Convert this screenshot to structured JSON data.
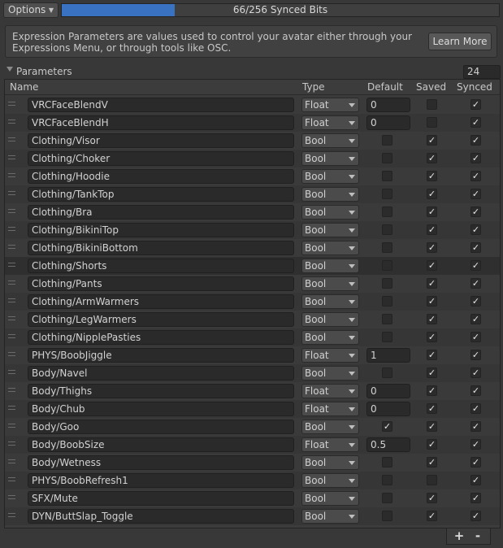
{
  "toolbar": {
    "options_label": "Options",
    "progress_fraction": 0.2578,
    "progress_text": "66/256 Synced Bits"
  },
  "info": {
    "message": "Expression Parameters are values used to control your avatar either through your Expressions Menu, or through tools like OSC.",
    "learn_more": "Learn More"
  },
  "parameters": {
    "header": "Parameters",
    "count": "24",
    "columns": {
      "name": "Name",
      "type": "Type",
      "default": "Default",
      "saved": "Saved",
      "synced": "Synced"
    },
    "rows": [
      {
        "name": "VRCFaceBlendV",
        "type": "Float",
        "default": "0",
        "saved": false,
        "synced": true
      },
      {
        "name": "VRCFaceBlendH",
        "type": "Float",
        "default": "0",
        "saved": false,
        "synced": true
      },
      {
        "name": "Clothing/Visor",
        "type": "Bool",
        "default": false,
        "saved": true,
        "synced": true
      },
      {
        "name": "Clothing/Choker",
        "type": "Bool",
        "default": false,
        "saved": true,
        "synced": true
      },
      {
        "name": "Clothing/Hoodie",
        "type": "Bool",
        "default": false,
        "saved": true,
        "synced": true
      },
      {
        "name": "Clothing/TankTop",
        "type": "Bool",
        "default": false,
        "saved": true,
        "synced": true
      },
      {
        "name": "Clothing/Bra",
        "type": "Bool",
        "default": false,
        "saved": true,
        "synced": true
      },
      {
        "name": "Clothing/BikiniTop",
        "type": "Bool",
        "default": false,
        "saved": true,
        "synced": true
      },
      {
        "name": "Clothing/BikiniBottom",
        "type": "Bool",
        "default": false,
        "saved": true,
        "synced": true
      },
      {
        "name": "Clothing/Shorts",
        "type": "Bool",
        "default": false,
        "saved": true,
        "synced": true,
        "selected": true
      },
      {
        "name": "Clothing/Pants",
        "type": "Bool",
        "default": false,
        "saved": true,
        "synced": true
      },
      {
        "name": "Clothing/ArmWarmers",
        "type": "Bool",
        "default": false,
        "saved": true,
        "synced": true
      },
      {
        "name": "Clothing/LegWarmers",
        "type": "Bool",
        "default": false,
        "saved": true,
        "synced": true
      },
      {
        "name": "Clothing/NipplePasties",
        "type": "Bool",
        "default": false,
        "saved": true,
        "synced": true
      },
      {
        "name": "PHYS/BoobJiggle",
        "type": "Float",
        "default": "1",
        "saved": true,
        "synced": true
      },
      {
        "name": "Body/Navel",
        "type": "Bool",
        "default": false,
        "saved": true,
        "synced": true
      },
      {
        "name": "Body/Thighs",
        "type": "Float",
        "default": "0",
        "saved": true,
        "synced": true
      },
      {
        "name": "Body/Chub",
        "type": "Float",
        "default": "0",
        "saved": true,
        "synced": true
      },
      {
        "name": "Body/Goo",
        "type": "Bool",
        "default": true,
        "saved": true,
        "synced": true
      },
      {
        "name": "Body/BoobSize",
        "type": "Float",
        "default": "0.5",
        "saved": true,
        "synced": true
      },
      {
        "name": "Body/Wetness",
        "type": "Bool",
        "default": false,
        "saved": true,
        "synced": true
      },
      {
        "name": "PHYS/BoobRefresh1",
        "type": "Bool",
        "default": false,
        "saved": false,
        "synced": true
      },
      {
        "name": "SFX/Mute",
        "type": "Bool",
        "default": false,
        "saved": true,
        "synced": true
      },
      {
        "name": "DYN/ButtSlap_Toggle",
        "type": "Bool",
        "default": false,
        "saved": true,
        "synced": true
      }
    ]
  },
  "footer": {
    "add_label": "+",
    "remove_label": "-"
  }
}
